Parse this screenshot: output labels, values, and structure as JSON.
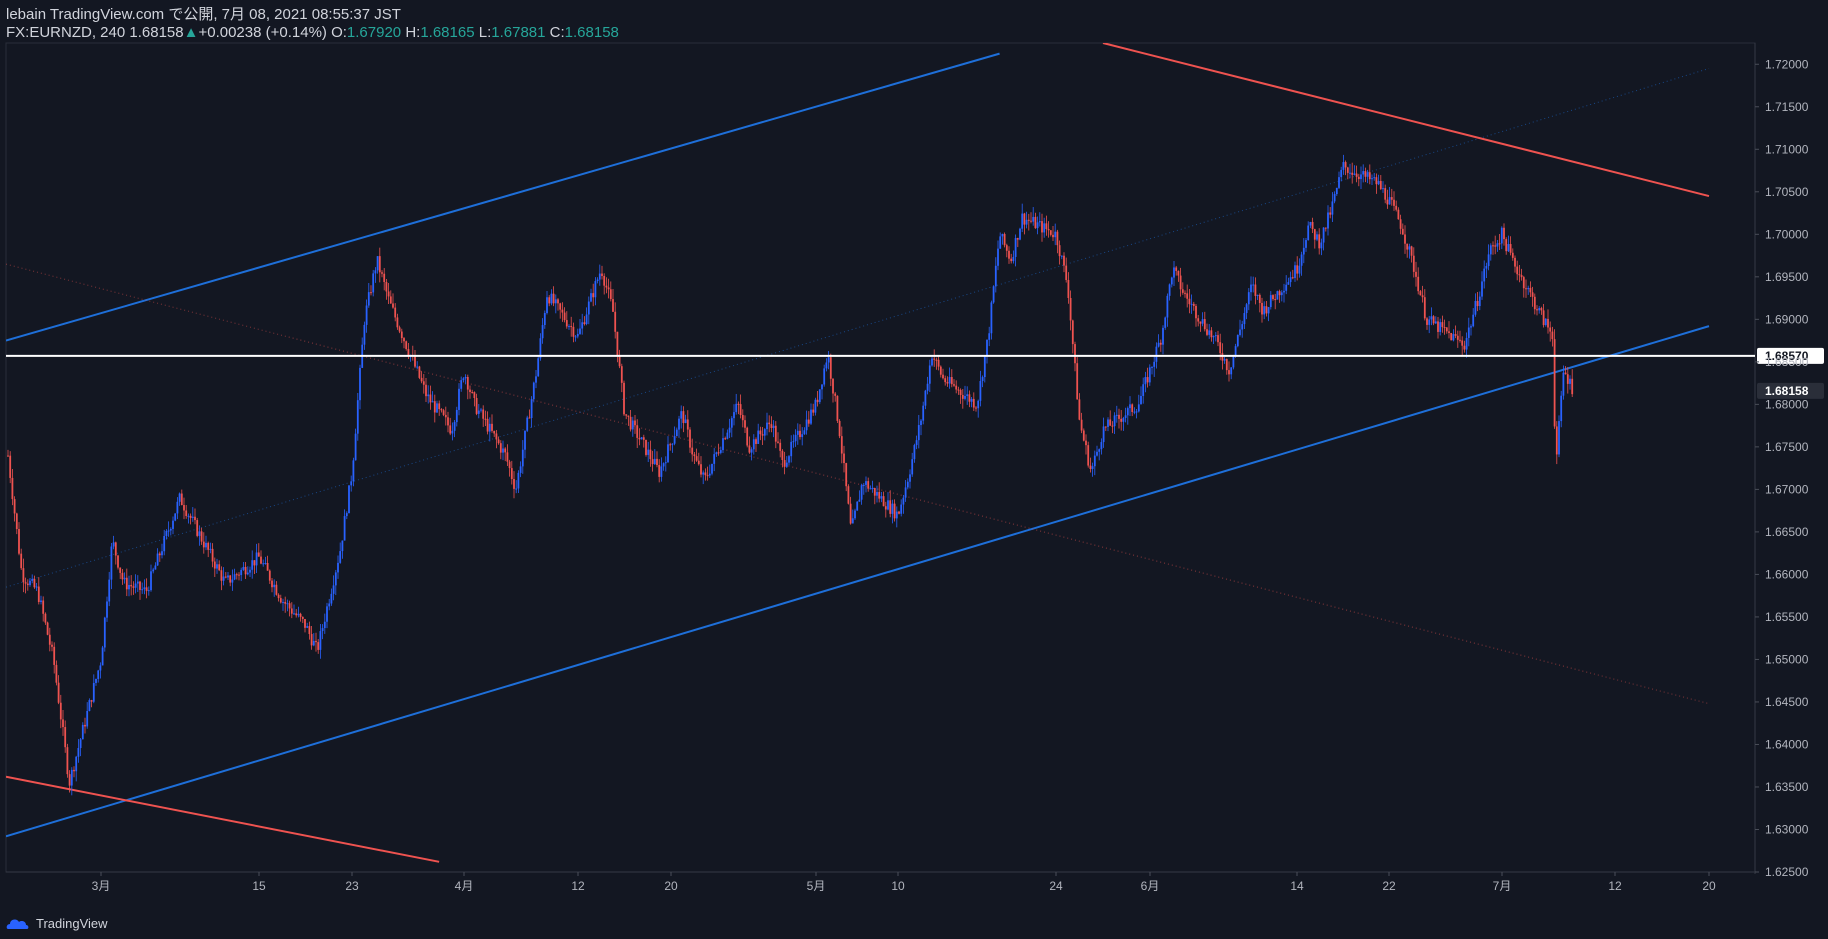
{
  "header": {
    "publish_line": "lebain TradingView.com で公開, 7月 08, 2021 08:55:37 JST",
    "symbol": "FX:EURNZD, 240",
    "last": "1.68158",
    "change": "+0.00238 (+0.14%)",
    "o_label": "O:",
    "o_value": "1.67920",
    "h_label": "H:",
    "h_value": "1.68165",
    "l_label": "L:",
    "l_value": "1.67881",
    "c_label": "C:",
    "c_value": "1.68158"
  },
  "footer": {
    "brand": "TradingView"
  },
  "colors": {
    "background": "#131722",
    "up": "#2962ff",
    "down": "#ef5350",
    "channel": "#1e6fd9",
    "downtrend": "#ef5350",
    "level": "#ffffff"
  },
  "chart_data": {
    "type": "candlestick",
    "symbol": "FX:EURNZD",
    "interval": "240",
    "ylim": [
      1.625,
      1.7225
    ],
    "price_ticks": [
      "1.72000",
      "1.71500",
      "1.71000",
      "1.70500",
      "1.70000",
      "1.69500",
      "1.69000",
      "1.68500",
      "1.68000",
      "1.67500",
      "1.67000",
      "1.66500",
      "1.66000",
      "1.65500",
      "1.65000",
      "1.64500",
      "1.64000",
      "1.63500",
      "1.63000",
      "1.62500"
    ],
    "time_labels": [
      {
        "label": "3月",
        "date": "2021-03-01"
      },
      {
        "label": "15",
        "date": "2021-03-15"
      },
      {
        "label": "23",
        "date": "2021-03-23"
      },
      {
        "label": "4月",
        "date": "2021-04-01"
      },
      {
        "label": "12",
        "date": "2021-04-12"
      },
      {
        "label": "20",
        "date": "2021-04-20"
      },
      {
        "label": "5月",
        "date": "2021-05-03"
      },
      {
        "label": "10",
        "date": "2021-05-10"
      },
      {
        "label": "24",
        "date": "2021-05-24"
      },
      {
        "label": "6月",
        "date": "2021-06-01"
      },
      {
        "label": "14",
        "date": "2021-06-14"
      },
      {
        "label": "22",
        "date": "2021-06-22"
      },
      {
        "label": "7月",
        "date": "2021-07-01"
      },
      {
        "label": "12",
        "date": "2021-07-12"
      },
      {
        "label": "20",
        "date": "2021-07-20"
      }
    ],
    "price_labels": [
      {
        "value": "1.68570",
        "role": "horizontal-level"
      },
      {
        "value": "1.68158",
        "role": "last-price"
      }
    ],
    "horizontal_level": 1.6857,
    "last_price": 1.68158,
    "close_path": [
      {
        "date": "2021-02-23",
        "close": 1.676
      },
      {
        "date": "2021-02-24",
        "close": 1.66
      },
      {
        "date": "2021-02-25",
        "close": 1.658
      },
      {
        "date": "2021-02-26",
        "close": 1.65
      },
      {
        "date": "2021-02-27",
        "close": 1.6355
      },
      {
        "date": "2021-03-01",
        "close": 1.65
      },
      {
        "date": "2021-03-02",
        "close": 1.664
      },
      {
        "date": "2021-03-03",
        "close": 1.659
      },
      {
        "date": "2021-03-05",
        "close": 1.658
      },
      {
        "date": "2021-03-08",
        "close": 1.669
      },
      {
        "date": "2021-03-10",
        "close": 1.664
      },
      {
        "date": "2021-03-12",
        "close": 1.659
      },
      {
        "date": "2021-03-15",
        "close": 1.662
      },
      {
        "date": "2021-03-17",
        "close": 1.657
      },
      {
        "date": "2021-03-19",
        "close": 1.654
      },
      {
        "date": "2021-03-20",
        "close": 1.651
      },
      {
        "date": "2021-03-22",
        "close": 1.663
      },
      {
        "date": "2021-03-23",
        "close": 1.672
      },
      {
        "date": "2021-03-24",
        "close": 1.69
      },
      {
        "date": "2021-03-25",
        "close": 1.697
      },
      {
        "date": "2021-03-26",
        "close": 1.692
      },
      {
        "date": "2021-03-29",
        "close": 1.681
      },
      {
        "date": "2021-03-31",
        "close": 1.677
      },
      {
        "date": "2021-04-01",
        "close": 1.684
      },
      {
        "date": "2021-04-02",
        "close": 1.68
      },
      {
        "date": "2021-04-05",
        "close": 1.674
      },
      {
        "date": "2021-04-06",
        "close": 1.67
      },
      {
        "date": "2021-04-08",
        "close": 1.684
      },
      {
        "date": "2021-04-09",
        "close": 1.693
      },
      {
        "date": "2021-04-12",
        "close": 1.688
      },
      {
        "date": "2021-04-14",
        "close": 1.696
      },
      {
        "date": "2021-04-15",
        "close": 1.691
      },
      {
        "date": "2021-04-16",
        "close": 1.679
      },
      {
        "date": "2021-04-19",
        "close": 1.672
      },
      {
        "date": "2021-04-21",
        "close": 1.679
      },
      {
        "date": "2021-04-22",
        "close": 1.674
      },
      {
        "date": "2021-04-23",
        "close": 1.671
      },
      {
        "date": "2021-04-26",
        "close": 1.68
      },
      {
        "date": "2021-04-27",
        "close": 1.675
      },
      {
        "date": "2021-04-29",
        "close": 1.678
      },
      {
        "date": "2021-04-30",
        "close": 1.673
      },
      {
        "date": "2021-05-03",
        "close": 1.68
      },
      {
        "date": "2021-05-04",
        "close": 1.686
      },
      {
        "date": "2021-05-05",
        "close": 1.677
      },
      {
        "date": "2021-05-06",
        "close": 1.665
      },
      {
        "date": "2021-05-07",
        "close": 1.671
      },
      {
        "date": "2021-05-10",
        "close": 1.667
      },
      {
        "date": "2021-05-11",
        "close": 1.672
      },
      {
        "date": "2021-05-12",
        "close": 1.678
      },
      {
        "date": "2021-05-13",
        "close": 1.686
      },
      {
        "date": "2021-05-14",
        "close": 1.683
      },
      {
        "date": "2021-05-17",
        "close": 1.68
      },
      {
        "date": "2021-05-18",
        "close": 1.688
      },
      {
        "date": "2021-05-19",
        "close": 1.7
      },
      {
        "date": "2021-05-20",
        "close": 1.697
      },
      {
        "date": "2021-05-21",
        "close": 1.702
      },
      {
        "date": "2021-05-24",
        "close": 1.7
      },
      {
        "date": "2021-05-25",
        "close": 1.694
      },
      {
        "date": "2021-05-26",
        "close": 1.678
      },
      {
        "date": "2021-05-27",
        "close": 1.672
      },
      {
        "date": "2021-05-28",
        "close": 1.677
      },
      {
        "date": "2021-05-31",
        "close": 1.68
      },
      {
        "date": "2021-06-01",
        "close": 1.684
      },
      {
        "date": "2021-06-02",
        "close": 1.688
      },
      {
        "date": "2021-06-03",
        "close": 1.696
      },
      {
        "date": "2021-06-04",
        "close": 1.693
      },
      {
        "date": "2021-06-07",
        "close": 1.687
      },
      {
        "date": "2021-06-08",
        "close": 1.684
      },
      {
        "date": "2021-06-09",
        "close": 1.689
      },
      {
        "date": "2021-06-10",
        "close": 1.694
      },
      {
        "date": "2021-06-11",
        "close": 1.691
      },
      {
        "date": "2021-06-14",
        "close": 1.696
      },
      {
        "date": "2021-06-15",
        "close": 1.701
      },
      {
        "date": "2021-06-16",
        "close": 1.699
      },
      {
        "date": "2021-06-17",
        "close": 1.703
      },
      {
        "date": "2021-06-18",
        "close": 1.708
      },
      {
        "date": "2021-06-21",
        "close": 1.706
      },
      {
        "date": "2021-06-22",
        "close": 1.704
      },
      {
        "date": "2021-06-23",
        "close": 1.701
      },
      {
        "date": "2021-06-24",
        "close": 1.696
      },
      {
        "date": "2021-06-25",
        "close": 1.69
      },
      {
        "date": "2021-06-28",
        "close": 1.687
      },
      {
        "date": "2021-06-29",
        "close": 1.692
      },
      {
        "date": "2021-06-30",
        "close": 1.698
      },
      {
        "date": "2021-07-01",
        "close": 1.7
      },
      {
        "date": "2021-07-02",
        "close": 1.697
      },
      {
        "date": "2021-07-05",
        "close": 1.69
      },
      {
        "date": "2021-07-06",
        "close": 1.688
      },
      {
        "date": "2021-07-06",
        "close": 1.672
      },
      {
        "date": "2021-07-07",
        "close": 1.684
      },
      {
        "date": "2021-07-08",
        "close": 1.6816
      }
    ],
    "trendlines": [
      {
        "name": "channel-upper",
        "color": "#1e6fd9",
        "from": {
          "date": "2021-02-23",
          "price": 1.6875
        },
        "to": {
          "date": "2021-05-19",
          "price": 1.72125
        }
      },
      {
        "name": "channel-lower",
        "color": "#1e6fd9",
        "from": {
          "date": "2021-02-23",
          "price": 1.6292
        },
        "to": {
          "date": "2021-07-20",
          "price": 1.6892
        }
      },
      {
        "name": "channel-middle",
        "color": "#1e6fd9",
        "dotted": true,
        "from": {
          "date": "2021-02-23",
          "price": 1.6585
        },
        "to": {
          "date": "2021-07-20",
          "price": 1.7195
        }
      },
      {
        "name": "down-lower",
        "color": "#ef5350",
        "from": {
          "date": "2021-02-23",
          "price": 1.6362
        },
        "to": {
          "date": "2021-03-30",
          "price": 1.6262
        }
      },
      {
        "name": "down-upper",
        "color": "#ef5350",
        "from": {
          "date": "2021-05-28",
          "price": 1.7225
        },
        "to": {
          "date": "2021-07-20",
          "price": 1.7045
        }
      },
      {
        "name": "down-middle",
        "color": "#ef5350",
        "dotted": true,
        "from": {
          "date": "2021-02-23",
          "price": 1.6965
        },
        "to": {
          "date": "2021-07-20",
          "price": 1.6448
        }
      }
    ]
  }
}
